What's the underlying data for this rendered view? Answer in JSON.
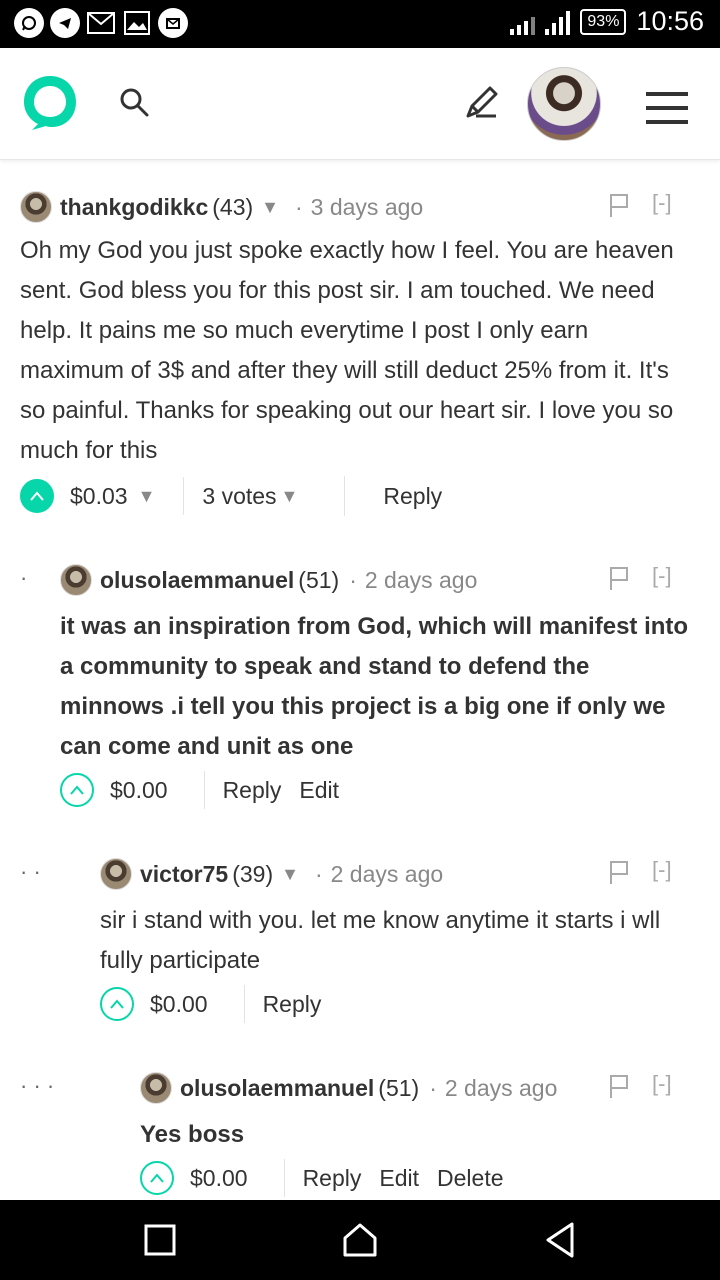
{
  "status_bar": {
    "battery": "93%",
    "time": "10:56",
    "network": "H+"
  },
  "header": {
    "icons": [
      "steemit-logo-icon",
      "search-icon",
      "pen-icon",
      "avatar",
      "menu-icon"
    ]
  },
  "comments": [
    {
      "author": "thankgodikkc",
      "rep": "(43)",
      "time": "3 days ago",
      "collapse": "[-]",
      "body": "Oh my God you just spoke exactly how I feel. You are heaven sent. God bless you for this post sir. I am touched. We need help. It pains me so much everytime I post I only earn maximum of 3$ and after they will still deduct 25% from it. It's so painful. Thanks for speaking out our heart sir. I love you so much for this",
      "payout": "$0.03",
      "votes": "3 votes",
      "reply": "Reply"
    },
    {
      "dots": "·",
      "author": "olusolaemmanuel",
      "rep": "(51)",
      "time": "2 days ago",
      "collapse": "[-]",
      "body": "it was an inspiration from God, which will manifest into a community to speak and stand to defend the minnows .i tell you this project is a big one if only we can come and unit as one",
      "payout": "$0.00",
      "reply": "Reply",
      "edit": "Edit"
    },
    {
      "dots": "·   ·",
      "author": "victor75",
      "rep": "(39)",
      "time": "2 days ago",
      "collapse": "[-]",
      "body": "sir i stand with you. let me know anytime it starts i wll fully participate",
      "payout": "$0.00",
      "reply": "Reply"
    },
    {
      "dots": "·   ·   ·",
      "author": "olusolaemmanuel",
      "rep": "(51)",
      "time": "2 days ago",
      "collapse": "[-]",
      "body": "Yes boss",
      "payout": "$0.00",
      "reply": "Reply",
      "edit": "Edit",
      "delete": "Delete"
    }
  ],
  "colors": {
    "accent": "#06d6a9",
    "text": "#333333",
    "muted": "#888888"
  }
}
